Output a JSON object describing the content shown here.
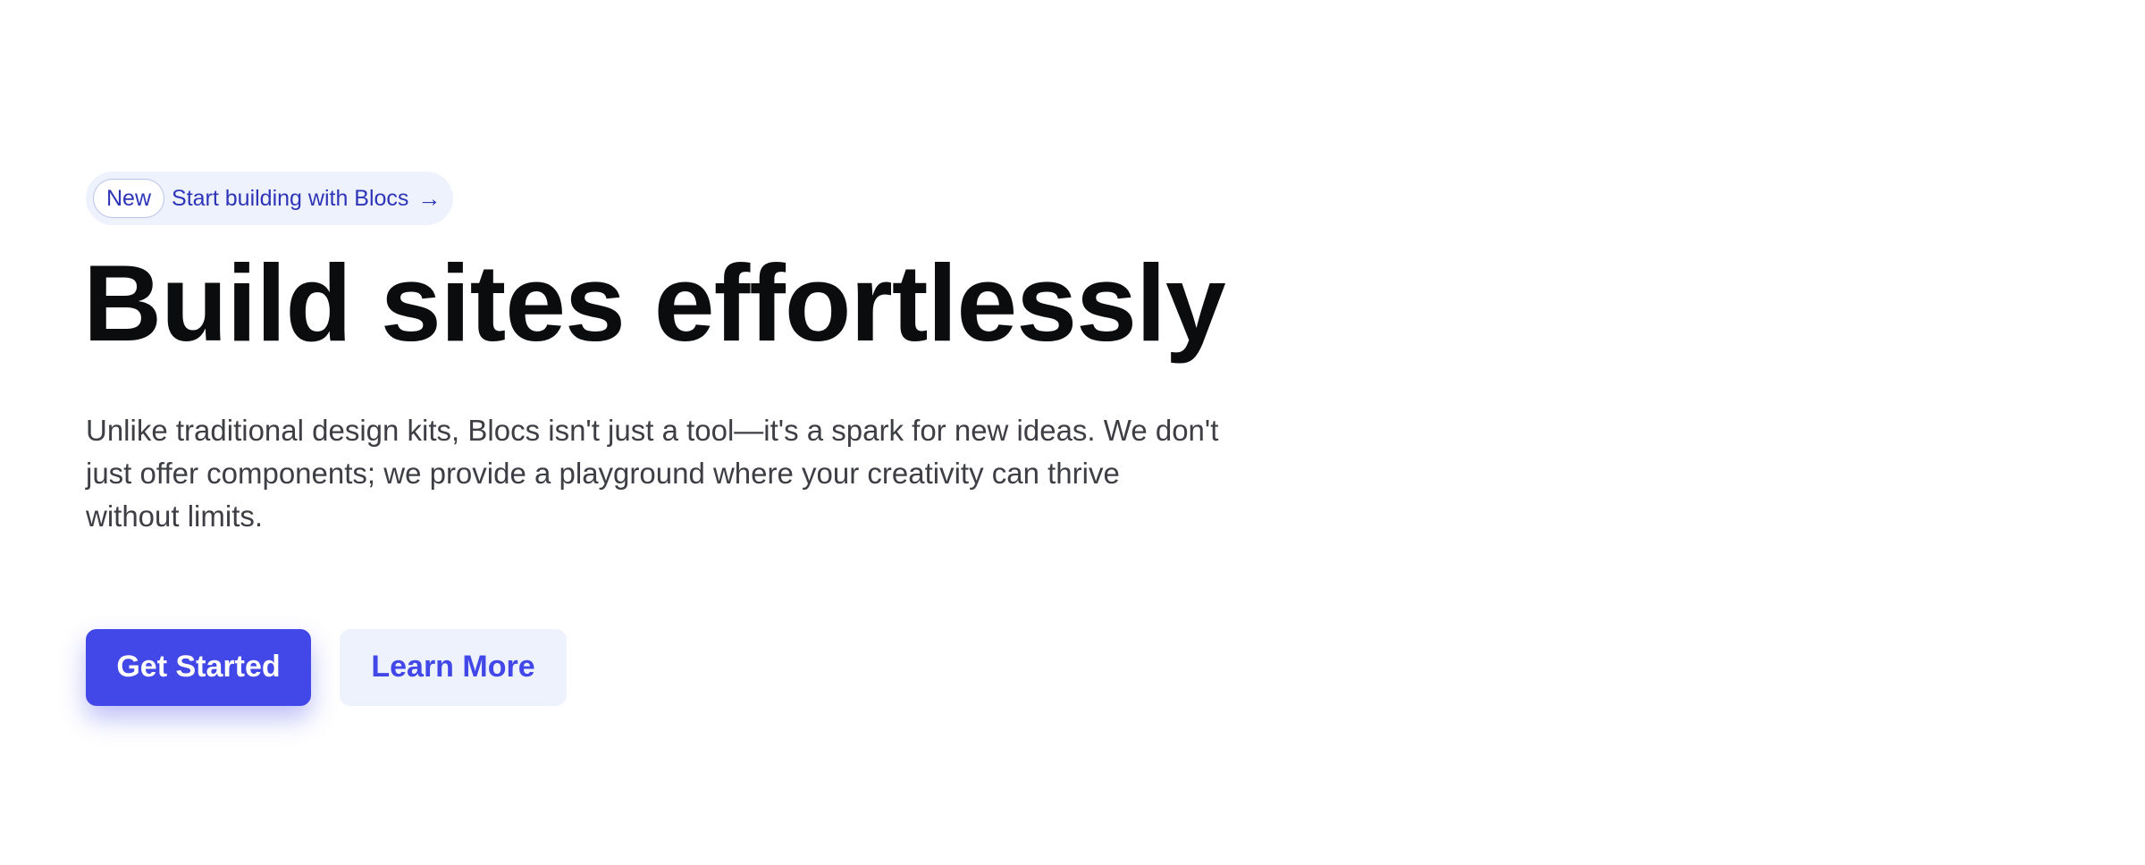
{
  "announcement": {
    "badge": "New",
    "text": "Start building with Blocs",
    "arrow": "→",
    "icon": "arrow-right-icon"
  },
  "hero": {
    "headline": "Build sites effortlessly",
    "description": "Unlike traditional design kits, Blocs isn't just a tool—it's a spark for new ideas. We don't just offer components; we provide a playground where your creativity can thrive without limits."
  },
  "actions": {
    "primary_label": "Get Started",
    "secondary_label": "Learn More"
  },
  "colors": {
    "accent": "#4247e7",
    "accent_soft": "#eef2fc",
    "heading": "#0b0c0e",
    "body": "#3d3f44"
  }
}
